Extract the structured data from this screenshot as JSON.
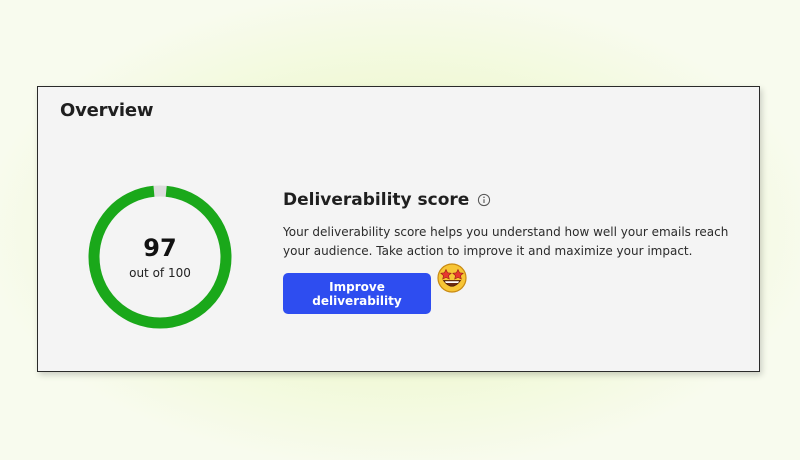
{
  "card": {
    "title": "Overview"
  },
  "score": {
    "value": "97",
    "max_label": "out of 100",
    "fraction": 0.97,
    "ring_color": "#1aa81a",
    "track_color": "#dcdcdc"
  },
  "deliverability": {
    "heading": "Deliverability score",
    "info_icon": "info-circle-icon",
    "description": "Your deliverability score helps you understand how well your emails reach your audience. Take action to improve it and maximize your impact.",
    "button_label": "Improve deliverability",
    "button_color": "#2e4df0",
    "emoji_icon": "star-struck-emoji-icon"
  }
}
